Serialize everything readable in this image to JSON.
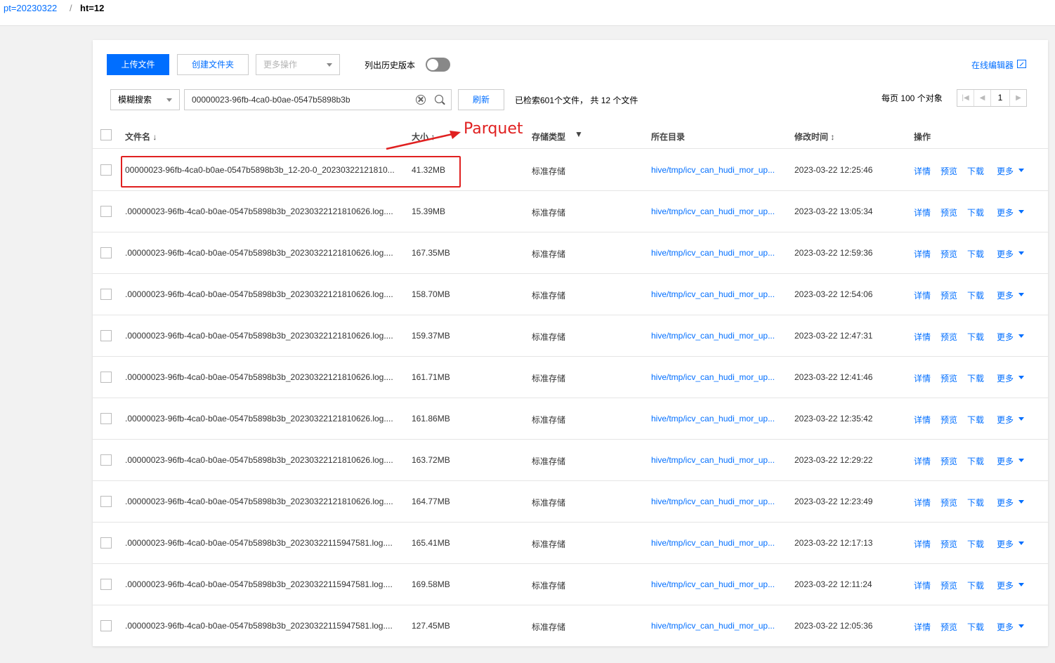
{
  "breadcrumb": {
    "link": "pt=20230322",
    "sep": "/",
    "current": "ht=12"
  },
  "toolbar": {
    "upload": "上传文件",
    "create_folder": "创建文件夹",
    "more_ops": "更多操作",
    "history_label": "列出历史版本",
    "history_enabled": false,
    "online_editor": "在线编辑器"
  },
  "search": {
    "mode": "模糊搜索",
    "query": "00000023-96fb-4ca0-b0ae-0547b5898b3b",
    "refresh": "刷新",
    "result": "已检索601个文件， 共 12 个文件"
  },
  "pagination": {
    "per_page": "每页 100 个对象",
    "current_page": "1"
  },
  "columns": {
    "name": "文件名 ↓",
    "size": "大小 ↕",
    "storage": "存储类型",
    "directory": "所在目录",
    "modified": "修改时间 ↕",
    "actions": "操作"
  },
  "row_actions": {
    "detail": "详情",
    "preview": "预览",
    "download": "下载",
    "more": "更多"
  },
  "rows": [
    {
      "name": "00000023-96fb-4ca0-b0ae-0547b5898b3b_12-20-0_20230322121810...",
      "size": "41.32MB",
      "storage": "标准存储",
      "dir": "hive/tmp/icv_can_hudi_mor_up...",
      "time": "2023-03-22 12:25:46"
    },
    {
      "name": ".00000023-96fb-4ca0-b0ae-0547b5898b3b_20230322121810626.log....",
      "size": "15.39MB",
      "storage": "标准存储",
      "dir": "hive/tmp/icv_can_hudi_mor_up...",
      "time": "2023-03-22 13:05:34"
    },
    {
      "name": ".00000023-96fb-4ca0-b0ae-0547b5898b3b_20230322121810626.log....",
      "size": "167.35MB",
      "storage": "标准存储",
      "dir": "hive/tmp/icv_can_hudi_mor_up...",
      "time": "2023-03-22 12:59:36"
    },
    {
      "name": ".00000023-96fb-4ca0-b0ae-0547b5898b3b_20230322121810626.log....",
      "size": "158.70MB",
      "storage": "标准存储",
      "dir": "hive/tmp/icv_can_hudi_mor_up...",
      "time": "2023-03-22 12:54:06"
    },
    {
      "name": ".00000023-96fb-4ca0-b0ae-0547b5898b3b_20230322121810626.log....",
      "size": "159.37MB",
      "storage": "标准存储",
      "dir": "hive/tmp/icv_can_hudi_mor_up...",
      "time": "2023-03-22 12:47:31"
    },
    {
      "name": ".00000023-96fb-4ca0-b0ae-0547b5898b3b_20230322121810626.log....",
      "size": "161.71MB",
      "storage": "标准存储",
      "dir": "hive/tmp/icv_can_hudi_mor_up...",
      "time": "2023-03-22 12:41:46"
    },
    {
      "name": ".00000023-96fb-4ca0-b0ae-0547b5898b3b_20230322121810626.log....",
      "size": "161.86MB",
      "storage": "标准存储",
      "dir": "hive/tmp/icv_can_hudi_mor_up...",
      "time": "2023-03-22 12:35:42"
    },
    {
      "name": ".00000023-96fb-4ca0-b0ae-0547b5898b3b_20230322121810626.log....",
      "size": "163.72MB",
      "storage": "标准存储",
      "dir": "hive/tmp/icv_can_hudi_mor_up...",
      "time": "2023-03-22 12:29:22"
    },
    {
      "name": ".00000023-96fb-4ca0-b0ae-0547b5898b3b_20230322121810626.log....",
      "size": "164.77MB",
      "storage": "标准存储",
      "dir": "hive/tmp/icv_can_hudi_mor_up...",
      "time": "2023-03-22 12:23:49"
    },
    {
      "name": ".00000023-96fb-4ca0-b0ae-0547b5898b3b_20230322115947581.log....",
      "size": "165.41MB",
      "storage": "标准存储",
      "dir": "hive/tmp/icv_can_hudi_mor_up...",
      "time": "2023-03-22 12:17:13"
    },
    {
      "name": ".00000023-96fb-4ca0-b0ae-0547b5898b3b_20230322115947581.log....",
      "size": "169.58MB",
      "storage": "标准存储",
      "dir": "hive/tmp/icv_can_hudi_mor_up...",
      "time": "2023-03-22 12:11:24"
    },
    {
      "name": ".00000023-96fb-4ca0-b0ae-0547b5898b3b_20230322115947581.log....",
      "size": "127.45MB",
      "storage": "标准存储",
      "dir": "hive/tmp/icv_can_hudi_mor_up...",
      "time": "2023-03-22 12:05:36"
    }
  ],
  "annotation": {
    "label": "Parquet",
    "color": "#e02020"
  },
  "colors": {
    "accent": "#006eff"
  }
}
